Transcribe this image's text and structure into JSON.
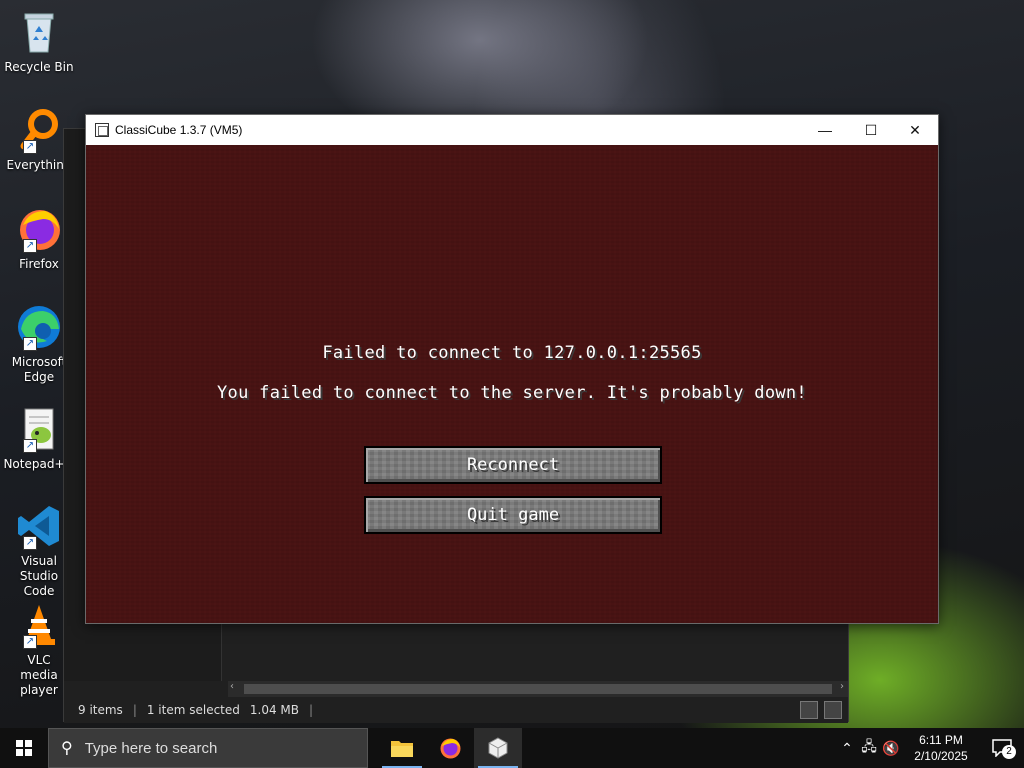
{
  "desktop": {
    "icons": [
      {
        "label": "Recycle Bin"
      },
      {
        "label": "Everything"
      },
      {
        "label": "Firefox"
      },
      {
        "label": "Microsoft Edge"
      },
      {
        "label": "Notepad++"
      },
      {
        "label": "Visual Studio Code"
      },
      {
        "label": "VLC media player"
      }
    ]
  },
  "explorer": {
    "status": {
      "items": "9 items",
      "selected": "1 item selected",
      "size": "1.04 MB"
    }
  },
  "window": {
    "title": "ClassiCube 1.3.7 (VM5)",
    "controls": {
      "minimize": "—",
      "maximize": "☐",
      "close": "✕"
    }
  },
  "game": {
    "title": "Failed to connect to 127.0.0.1:25565",
    "message": "You failed to connect to the server. It's probably down!",
    "buttons": {
      "reconnect": "Reconnect",
      "quit": "Quit game"
    },
    "colors": {
      "background": "#4b1414",
      "button": "#7a7a7a"
    }
  },
  "taskbar": {
    "search_placeholder": "Type here to search",
    "clock": {
      "time": "6:11 PM",
      "date": "2/10/2025"
    },
    "notification_count": "2"
  }
}
